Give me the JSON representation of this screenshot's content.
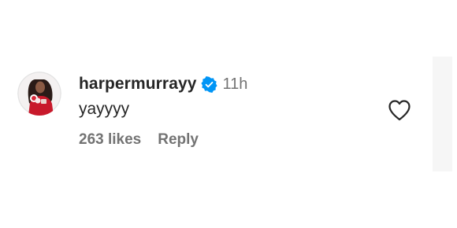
{
  "comment": {
    "username": "harpermurrayy",
    "verified": true,
    "verified_icon": "verified-badge-icon",
    "time": "11h",
    "text": "yayyyy",
    "likes": "263 likes",
    "reply_label": "Reply",
    "like_icon": "heart-icon"
  },
  "colors": {
    "verified": "#0095f6",
    "text": "#262626",
    "secondary": "#737373"
  }
}
